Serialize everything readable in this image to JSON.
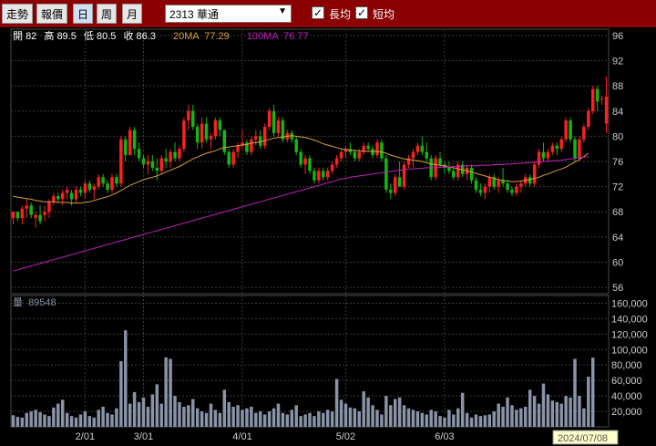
{
  "toolbar": {
    "tabs": [
      {
        "label": "走勢"
      },
      {
        "label": "報價"
      },
      {
        "label": "日"
      },
      {
        "label": "周"
      },
      {
        "label": "月"
      }
    ],
    "symbol_select": "2313 華通",
    "check_long": "長均",
    "check_short": "短均"
  },
  "colors": {
    "up": "#ff2020",
    "down": "#12b812",
    "ma20": "#d9a040",
    "ma100": "#c020c0",
    "volume": "#8a94a8",
    "toolbar": "#8b0000"
  },
  "chart_data": [
    {
      "type": "candlestick",
      "info": {
        "open_label": "開",
        "open": "82",
        "high_label": "高",
        "high": "89.5",
        "low_label": "低",
        "low": "80.5",
        "close_label": "收",
        "close": "86.3",
        "ma20_label": "20MA",
        "ma20": "77.29",
        "ma100_label": "100MA",
        "ma100": "76.77"
      },
      "ylim": [
        55,
        97
      ],
      "yticks": [
        "96",
        "92",
        "88",
        "84",
        "80",
        "76",
        "72",
        "68",
        "64",
        "60",
        "56"
      ],
      "xticks": [
        "2/01",
        "3/01",
        "4/01",
        "5/02",
        "6/03"
      ],
      "xtick_index": [
        16,
        29,
        51,
        74,
        96
      ],
      "grid": true,
      "candles": [
        [
          67,
          68,
          66,
          68
        ],
        [
          68,
          68,
          66.5,
          67
        ],
        [
          67,
          69,
          66,
          68.5
        ],
        [
          68.5,
          70,
          67,
          69
        ],
        [
          69,
          69.5,
          67,
          67.5
        ],
        [
          67,
          68,
          65.5,
          67.5
        ],
        [
          67.5,
          69,
          66,
          66.5
        ],
        [
          67.5,
          69,
          66.5,
          68
        ],
        [
          68,
          70,
          67,
          69.5
        ],
        [
          69.5,
          71,
          69,
          70.5
        ],
        [
          70.5,
          71,
          69.5,
          70
        ],
        [
          70,
          71.5,
          69,
          71
        ],
        [
          71,
          72,
          70,
          71.5
        ],
        [
          71,
          71.5,
          69,
          70
        ],
        [
          70,
          72,
          69.5,
          71.5
        ],
        [
          71.5,
          72,
          70.5,
          71
        ],
        [
          71,
          73,
          70,
          72.5
        ],
        [
          72.5,
          73,
          71,
          71.5
        ],
        [
          71.5,
          72.5,
          70,
          72
        ],
        [
          72,
          74,
          71.5,
          73.5
        ],
        [
          73.5,
          74,
          72,
          72.5
        ],
        [
          72.5,
          73,
          71,
          71.5
        ],
        [
          71.5,
          74,
          71,
          73.5
        ],
        [
          73.5,
          74,
          72,
          72.5
        ],
        [
          72.5,
          80,
          72,
          79.5
        ],
        [
          79.5,
          80,
          76,
          77
        ],
        [
          77,
          81.5,
          77,
          81
        ],
        [
          81,
          81.5,
          77,
          78
        ],
        [
          78,
          79,
          76,
          76.5
        ],
        [
          76.5,
          77,
          75,
          75.5
        ],
        [
          75.5,
          77,
          74,
          76
        ],
        [
          76,
          77,
          74.5,
          75
        ],
        [
          75,
          76.5,
          73,
          74.5
        ],
        [
          74.5,
          77,
          74,
          76.5
        ],
        [
          76.5,
          78,
          75,
          76
        ],
        [
          76,
          78,
          75,
          77.5
        ],
        [
          77.5,
          79,
          76,
          76.5
        ],
        [
          76.5,
          78.5,
          76,
          78
        ],
        [
          78,
          83,
          77.5,
          82.5
        ],
        [
          82.5,
          85,
          81,
          84
        ],
        [
          84,
          85,
          81,
          81.5
        ],
        [
          81.5,
          82,
          78,
          79
        ],
        [
          79,
          83,
          78,
          82
        ],
        [
          82,
          83,
          79,
          79.5
        ],
        [
          79.5,
          80.5,
          78,
          80
        ],
        [
          80,
          83,
          79.5,
          82.5
        ],
        [
          82.5,
          83,
          80,
          81
        ],
        [
          81,
          81,
          77,
          77.5
        ],
        [
          77.5,
          78,
          75,
          75.5
        ],
        [
          75.5,
          78,
          75,
          77.5
        ],
        [
          77.5,
          79,
          76.5,
          78.5
        ],
        [
          78.5,
          81,
          78,
          79
        ],
        [
          79,
          79.5,
          77,
          77.5
        ],
        [
          77.5,
          80,
          77,
          79.5
        ],
        [
          79.5,
          81,
          78.5,
          80
        ],
        [
          80,
          81,
          78,
          78.5
        ],
        [
          78.5,
          82,
          78,
          81.5
        ],
        [
          81.5,
          84.5,
          81,
          84
        ],
        [
          84,
          85,
          80,
          80.5
        ],
        [
          80.5,
          83,
          80,
          82.5
        ],
        [
          82.5,
          83,
          79,
          79.5
        ],
        [
          79.5,
          81,
          79,
          80.5
        ],
        [
          80.5,
          81,
          79,
          79.5
        ],
        [
          79.5,
          80,
          77,
          77.5
        ],
        [
          77.5,
          78,
          75,
          75.5
        ],
        [
          75.5,
          77,
          74,
          76.5
        ],
        [
          76.5,
          77,
          74,
          74.5
        ],
        [
          74.5,
          75,
          72.5,
          73
        ],
        [
          73,
          75,
          72.5,
          74.5
        ],
        [
          74.5,
          75,
          73,
          73.5
        ],
        [
          73.5,
          75,
          73,
          74.5
        ],
        [
          74.5,
          76,
          74,
          75.5
        ],
        [
          75.5,
          77,
          75,
          76.5
        ],
        [
          76.5,
          78,
          76,
          77.5
        ],
        [
          77.5,
          78.5,
          76.5,
          78
        ],
        [
          78,
          79,
          77,
          77.5
        ],
        [
          77.5,
          78,
          76,
          76.5
        ],
        [
          76.5,
          78,
          76,
          77.5
        ],
        [
          77.5,
          79,
          77,
          78.5
        ],
        [
          78.5,
          79,
          77.5,
          78
        ],
        [
          78,
          78.5,
          76.5,
          77
        ],
        [
          77,
          79.5,
          76.5,
          79
        ],
        [
          79,
          79.5,
          76,
          76.5
        ],
        [
          76.5,
          77,
          71,
          71.5
        ],
        [
          71.5,
          72.5,
          70,
          71
        ],
        [
          71,
          74,
          70.5,
          73.5
        ],
        [
          73.5,
          76,
          72,
          72
        ],
        [
          72,
          76,
          71.5,
          75.5
        ],
        [
          75.5,
          77,
          75,
          76.5
        ],
        [
          76.5,
          78,
          75,
          77.5
        ],
        [
          77.5,
          79,
          77,
          78.5
        ],
        [
          78.5,
          80,
          77,
          77.5
        ],
        [
          77.5,
          79,
          76,
          76.5
        ],
        [
          76.5,
          77,
          73,
          73.5
        ],
        [
          73.5,
          77,
          73,
          76.5
        ],
        [
          76.5,
          77.5,
          75,
          75.5
        ],
        [
          75.5,
          76,
          74,
          75
        ],
        [
          75,
          76,
          74,
          74.5
        ],
        [
          74.5,
          75,
          73,
          73.5
        ],
        [
          73.5,
          76,
          73,
          75.5
        ],
        [
          75.5,
          76,
          73.5,
          74
        ],
        [
          74,
          75.5,
          73,
          75
        ],
        [
          75,
          75.5,
          72.5,
          73
        ],
        [
          73,
          73.5,
          71,
          71.5
        ],
        [
          71.5,
          72.5,
          70.5,
          71
        ],
        [
          71,
          72.5,
          70,
          72
        ],
        [
          72,
          74,
          71,
          73.5
        ],
        [
          73.5,
          74,
          71.5,
          72
        ],
        [
          72,
          73.5,
          71,
          73
        ],
        [
          73,
          75,
          72,
          72.5
        ],
        [
          72.5,
          73,
          71,
          71.5
        ],
        [
          71.5,
          72,
          70.5,
          71
        ],
        [
          71,
          72.5,
          70.5,
          72
        ],
        [
          72,
          73,
          71,
          72.5
        ],
        [
          72.5,
          74,
          72,
          73.5
        ],
        [
          73.5,
          74,
          72,
          72.5
        ],
        [
          72.5,
          76,
          72,
          75.5
        ],
        [
          75.5,
          78,
          75,
          77.5
        ],
        [
          77.5,
          79,
          76,
          76.5
        ],
        [
          76.5,
          78,
          76,
          77.5
        ],
        [
          77.5,
          79,
          77,
          78.5
        ],
        [
          78.5,
          79,
          77,
          78
        ],
        [
          78,
          80,
          77.5,
          79.5
        ],
        [
          79.5,
          83,
          79,
          82.5
        ],
        [
          82.5,
          83,
          79,
          79.5
        ],
        [
          79.5,
          80,
          76,
          76.5
        ],
        [
          76.5,
          80,
          76,
          79.5
        ],
        [
          79.5,
          82,
          79,
          81.5
        ],
        [
          81.5,
          84.5,
          81,
          84
        ],
        [
          84,
          88,
          83.5,
          87.5
        ],
        [
          87.5,
          88,
          84,
          85.5
        ],
        [
          86,
          86.5,
          85,
          86
        ],
        [
          82,
          89.5,
          80.5,
          86.3
        ]
      ],
      "ma20": [
        70.5,
        70.3,
        70.2,
        70.1,
        70,
        69.8,
        69.7,
        69.6,
        69.6,
        69.6,
        69.5,
        69.5,
        69.5,
        69.4,
        69.4,
        69.4,
        69.5,
        69.6,
        69.8,
        70,
        70.2,
        70.4,
        70.7,
        71,
        71.4,
        71.8,
        72.2,
        72.5,
        72.8,
        73.1,
        73.3,
        73.5,
        73.7,
        74,
        74.3,
        74.6,
        74.9,
        75.2,
        75.6,
        76,
        76.4,
        76.7,
        77,
        77.3,
        77.5,
        77.7,
        78,
        78.2,
        78.3,
        78.4,
        78.5,
        78.6,
        78.7,
        78.9,
        79,
        79.1,
        79.3,
        79.5,
        79.7,
        79.8,
        79.9,
        80,
        80.1,
        80,
        79.9,
        79.8,
        79.6,
        79.4,
        79.1,
        78.8,
        78.6,
        78.4,
        78.2,
        78,
        77.9,
        77.8,
        77.7,
        77.7,
        77.6,
        77.6,
        77.6,
        77.6,
        77.5,
        77.3,
        77,
        76.8,
        76.6,
        76.4,
        76.3,
        76.2,
        76.1,
        76,
        75.8,
        75.6,
        75.5,
        75.4,
        75.3,
        75.1,
        75,
        74.8,
        74.7,
        74.5,
        74.3,
        74.1,
        73.9,
        73.7,
        73.5,
        73.3,
        73.1,
        73,
        72.9,
        72.8,
        72.8,
        72.9,
        73,
        73.1,
        73.3,
        73.5,
        73.8,
        74,
        74.3,
        74.6,
        74.8,
        75.1,
        75.5,
        75.9,
        76.3,
        76.8,
        77.29
      ],
      "ma100": [
        58.6,
        58.8,
        59,
        59.2,
        59.4,
        59.6,
        59.8,
        60,
        60.2,
        60.4,
        60.6,
        60.8,
        61,
        61.2,
        61.4,
        61.6,
        61.8,
        62,
        62.2,
        62.4,
        62.6,
        62.8,
        63,
        63.2,
        63.4,
        63.6,
        63.8,
        64,
        64.2,
        64.4,
        64.6,
        64.8,
        65,
        65.2,
        65.4,
        65.6,
        65.8,
        66,
        66.2,
        66.4,
        66.6,
        66.8,
        67,
        67.2,
        67.4,
        67.6,
        67.8,
        68,
        68.2,
        68.4,
        68.6,
        68.8,
        69,
        69.2,
        69.4,
        69.6,
        69.8,
        70,
        70.2,
        70.4,
        70.6,
        70.8,
        71,
        71.2,
        71.4,
        71.6,
        71.8,
        72,
        72.2,
        72.4,
        72.6,
        72.8,
        73,
        73.2,
        73.3,
        73.5,
        73.6,
        73.7,
        73.8,
        73.9,
        74,
        74.1,
        74.2,
        74.3,
        74.4,
        74.5,
        74.6,
        74.7,
        74.8,
        74.8,
        74.9,
        74.9,
        75,
        75,
        75,
        75.1,
        75.1,
        75.1,
        75.2,
        75.2,
        75.2,
        75.3,
        75.3,
        75.3,
        75.4,
        75.4,
        75.4,
        75.5,
        75.5,
        75.5,
        75.6,
        75.6,
        75.7,
        75.7,
        75.8,
        75.8,
        75.9,
        75.9,
        76,
        76,
        76.1,
        76.1,
        76.2,
        76.3,
        76.4,
        76.5,
        76.6,
        76.7,
        76.77
      ]
    },
    {
      "type": "bar",
      "label": "量",
      "last": "89548",
      "ylim": [
        0,
        170000
      ],
      "yticks": [
        "160,000",
        "140,000",
        "120,000",
        "100,000",
        "80,000",
        "60,000",
        "40,000",
        "20,000"
      ],
      "cursor_date": "2024/07/08",
      "values": [
        15000,
        13000,
        12000,
        18000,
        20000,
        22000,
        19000,
        16000,
        14000,
        25000,
        30000,
        35000,
        18000,
        14000,
        12000,
        16000,
        20000,
        14000,
        12000,
        22000,
        26000,
        18000,
        16000,
        24000,
        85000,
        125000,
        30000,
        45000,
        32000,
        38000,
        26000,
        42000,
        55000,
        30000,
        90000,
        88000,
        40000,
        32000,
        26000,
        28000,
        36000,
        24000,
        20000,
        18000,
        30000,
        22000,
        18000,
        48000,
        32000,
        26000,
        28000,
        22000,
        24000,
        26000,
        18000,
        20000,
        16000,
        20000,
        24000,
        30000,
        18000,
        16000,
        22000,
        28000,
        14000,
        16000,
        18000,
        14000,
        20000,
        18000,
        22000,
        20000,
        62000,
        35000,
        30000,
        25000,
        24000,
        20000,
        46000,
        38000,
        28000,
        22000,
        16000,
        40000,
        28000,
        36000,
        38000,
        28000,
        24000,
        22000,
        20000,
        18000,
        16000,
        22000,
        20000,
        14000,
        12000,
        22000,
        16000,
        24000,
        44000,
        18000,
        12000,
        16000,
        14000,
        15000,
        16000,
        20000,
        30000,
        26000,
        38000,
        28000,
        22000,
        24000,
        26000,
        48000,
        40000,
        30000,
        56000,
        42000,
        34000,
        32000,
        30000,
        40000,
        38000,
        88000,
        40000,
        24000,
        65000,
        89548
      ]
    }
  ]
}
